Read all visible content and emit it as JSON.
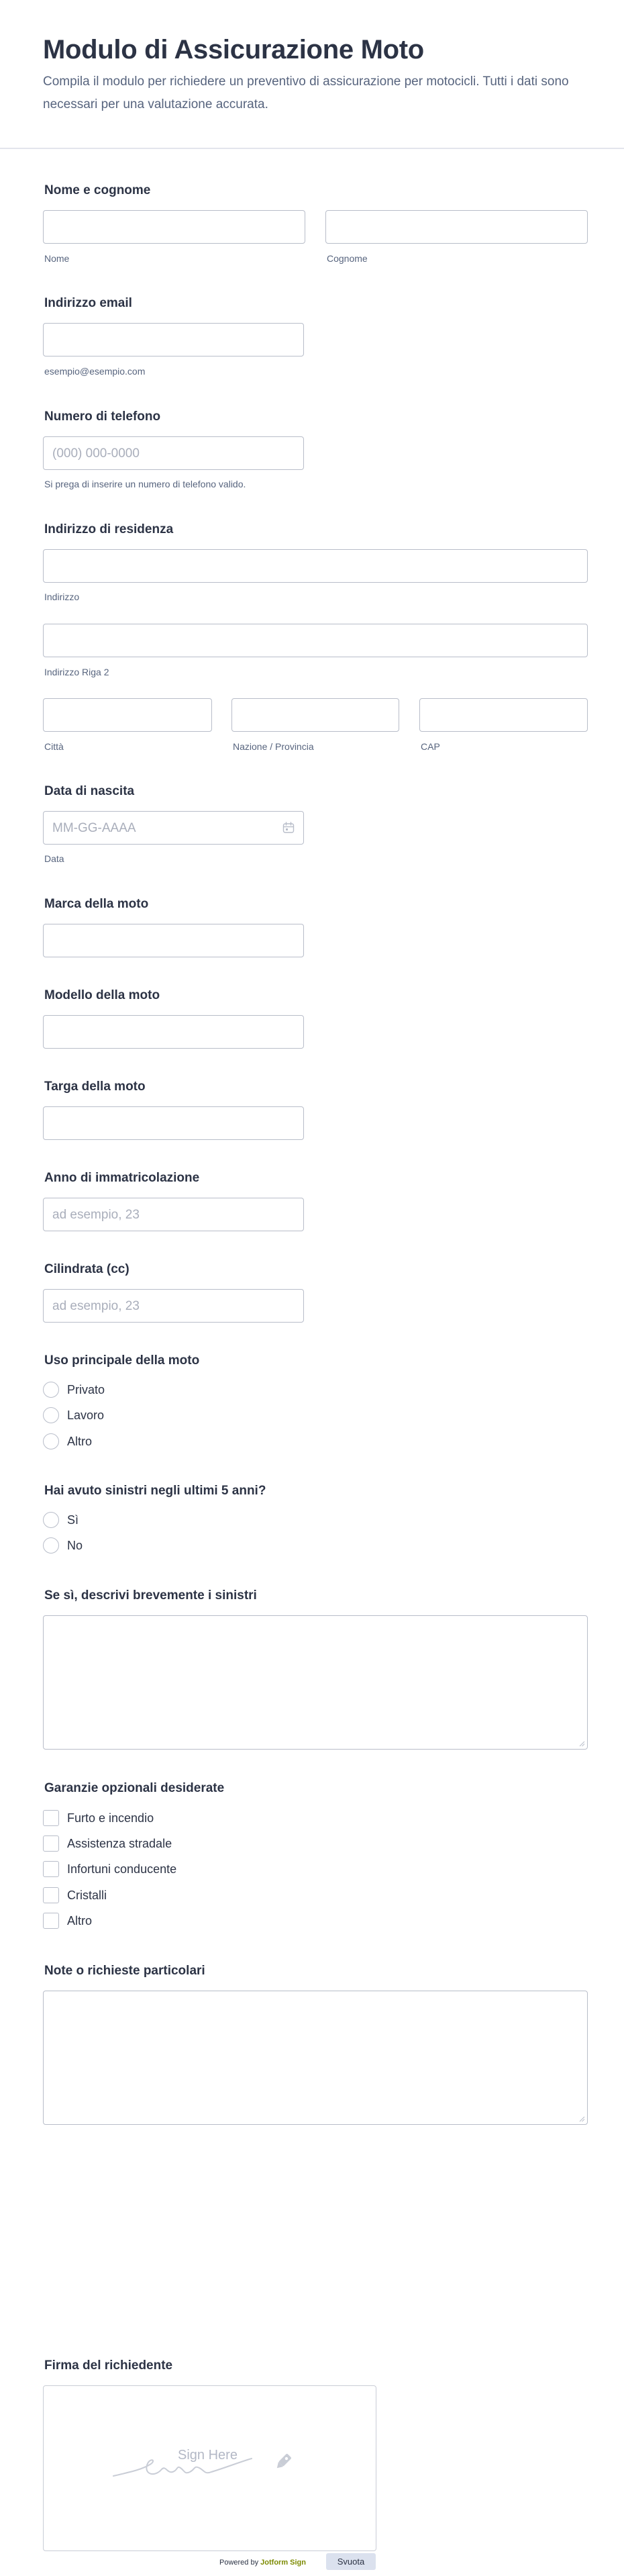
{
  "header": {
    "title": "Modulo di Assicurazione Moto",
    "subtitle": "Compila il modulo per richiedere un preventivo di assicurazione per motocicli. Tutti i dati sono necessari per una valutazione accurata."
  },
  "fields": {
    "name": {
      "label": "Nome e cognome",
      "first_sub": "Nome",
      "last_sub": "Cognome"
    },
    "email": {
      "label": "Indirizzo email",
      "sub": "esempio@esempio.com"
    },
    "phone": {
      "label": "Numero di telefono",
      "placeholder": "(000) 000-0000",
      "sub": "Si prega di inserire un numero di telefono valido."
    },
    "address": {
      "label": "Indirizzo di residenza",
      "line1_sub": "Indirizzo",
      "line2_sub": "Indirizzo Riga 2",
      "city_sub": "Città",
      "state_sub": "Nazione / Provincia",
      "zip_sub": "CAP"
    },
    "birthdate": {
      "label": "Data di nascita",
      "placeholder": "MM-GG-AAAA",
      "sub": "Data"
    },
    "make": {
      "label": "Marca della moto"
    },
    "model": {
      "label": "Modello della moto"
    },
    "plate": {
      "label": "Targa della moto"
    },
    "year": {
      "label": "Anno di immatricolazione",
      "placeholder": "ad esempio, 23"
    },
    "cc": {
      "label": "Cilindrata (cc)",
      "placeholder": "ad esempio, 23"
    },
    "usage": {
      "label": "Uso principale della moto",
      "options": [
        "Privato",
        "Lavoro",
        "Altro"
      ]
    },
    "claims": {
      "label": "Hai avuto sinistri negli ultimi 5 anni?",
      "options": [
        "Sì",
        "No"
      ]
    },
    "claims_desc": {
      "label": "Se sì, descrivi brevemente i sinistri"
    },
    "coverage": {
      "label": "Garanzie opzionali desiderate",
      "options": [
        "Furto e incendio",
        "Assistenza stradale",
        "Infortuni conducente",
        "Cristalli",
        "Altro"
      ]
    },
    "notes": {
      "label": "Note o richieste particolari"
    },
    "signature": {
      "label": "Firma del richiedente",
      "placeholder": "Sign Here"
    }
  },
  "footer": {
    "powered_by": "Powered by",
    "brand": "Jotform Sign",
    "clear_button": "Svuota"
  },
  "colors": {
    "accent": "#2c3345",
    "border": "#b8bdc9",
    "brand_green": "#7c8a00"
  }
}
